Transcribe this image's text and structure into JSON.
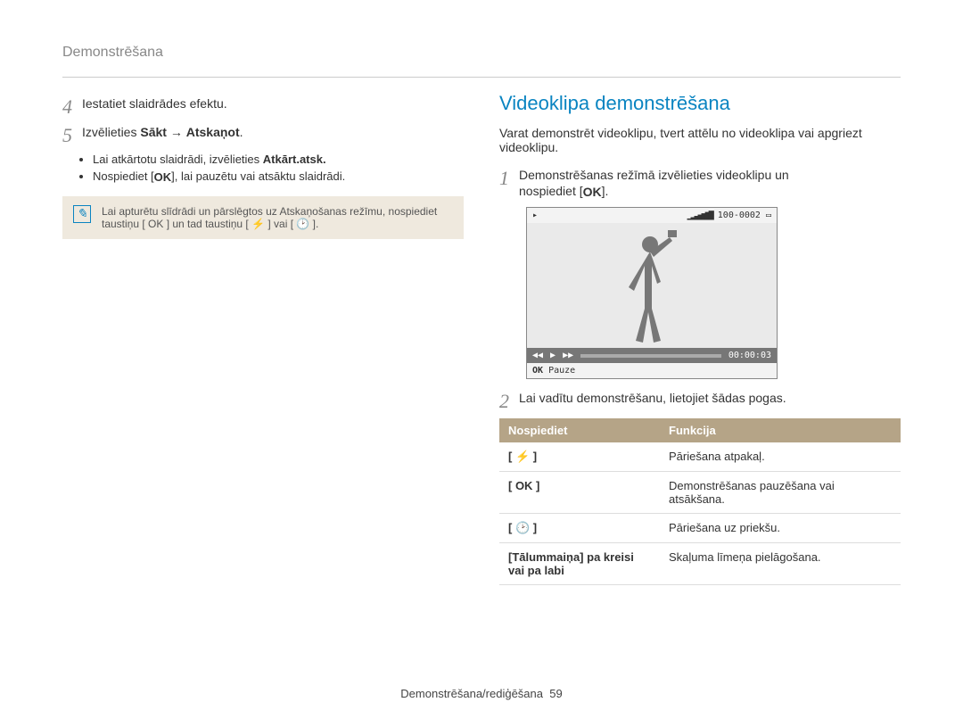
{
  "breadcrumb": "Demonstrēšana",
  "left": {
    "step4": {
      "num": "4",
      "text": "Iestatiet slaidrādes efektu."
    },
    "step5": {
      "num": "5",
      "prefix": "Izvēlieties ",
      "bold1": "Sākt",
      "arrow": " → ",
      "bold2": "Atskaņot",
      "suffix": "."
    },
    "bullets": {
      "b1_pre": "Lai atkārtotu slaidrādi, izvēlieties ",
      "b1_bold": "Atkārt.atsk.",
      "b2_pre": "Nospiediet [",
      "b2_icon": "OK",
      "b2_post": "], lai pauzētu vai atsāktu slaidrādi."
    },
    "note": "Lai apturētu slīdrādi un pārslēgtos uz Atskaņošanas režīmu, nospiediet taustiņu [ OK ] un tad taustiņu [ ⚡ ] vai [ 🕑 ]."
  },
  "right": {
    "title": "Videoklipa demonstrēšana",
    "intro": "Varat demonstrēt videoklipu, tvert attēlu no videoklipa vai apgriezt videoklipu.",
    "step1": {
      "num": "1",
      "line1": "Demonstrēšanas režīmā izvēlieties videoklipu un",
      "line2_pre": "nospiediet [",
      "line2_icon": "OK",
      "line2_post": "]."
    },
    "fig": {
      "top_left": "▸",
      "top_right": "100-0002",
      "time": "00:00:03",
      "footer_label": "OK",
      "footer_text": "Pauze"
    },
    "step2": {
      "num": "2",
      "text": "Lai vadītu demonstrēšanu, lietojiet šādas pogas."
    },
    "table": {
      "h1": "Nospiediet",
      "h2": "Funkcija",
      "rows": [
        {
          "k": "[ ⚡ ]",
          "v": "Pāriešana atpakaļ."
        },
        {
          "k": "[ OK ]",
          "v": "Demonstrēšanas pauzēšana vai atsākšana."
        },
        {
          "k": "[ 🕑 ]",
          "v": "Pāriešana uz priekšu."
        },
        {
          "k": "[Tālummaiņa] pa kreisi vai pa labi",
          "v": "Skaļuma līmeņa pielāgošana."
        }
      ]
    }
  },
  "footer": {
    "text": "Demonstrēšana/rediģēšana",
    "page": "59"
  }
}
